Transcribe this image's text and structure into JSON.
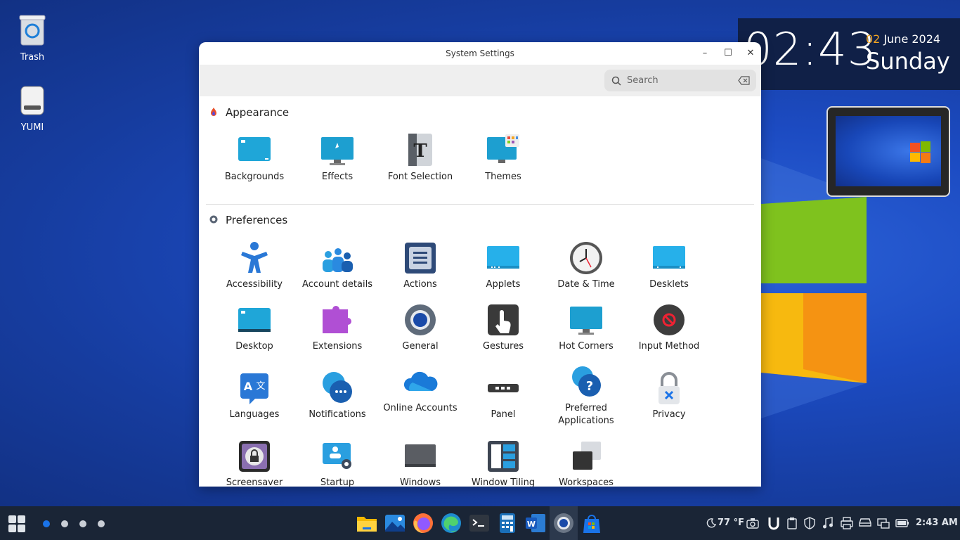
{
  "desktop": {
    "icons": [
      {
        "label": "Trash"
      },
      {
        "label": "YUMI"
      }
    ]
  },
  "clock": {
    "time": "02:43",
    "day": "02",
    "month_year": " June 2024",
    "weekday": "Sunday"
  },
  "window": {
    "title": "System Settings",
    "search_placeholder": "Search",
    "sections": {
      "appearance": {
        "heading": "Appearance",
        "items": [
          "Backgrounds",
          "Effects",
          "Font Selection",
          "Themes"
        ]
      },
      "preferences": {
        "heading": "Preferences",
        "items": [
          "Accessibility",
          "Account details",
          "Actions",
          "Applets",
          "Date & Time",
          "Desklets",
          "Desktop",
          "Extensions",
          "General",
          "Gestures",
          "Hot Corners",
          "Input Method",
          "Languages",
          "Notifications",
          "Online Accounts",
          "Panel",
          "Preferred Applications",
          "Privacy",
          "Screensaver",
          "Startup Applications",
          "Windows",
          "Window Tiling",
          "Workspaces"
        ]
      }
    }
  },
  "taskbar": {
    "weather": "77 °F",
    "clock": "2:43 AM",
    "apps": [
      "file-manager-icon",
      "image-viewer-icon",
      "firefox-icon",
      "edge-icon",
      "terminal-icon",
      "calculator-icon",
      "word-icon",
      "settings-icon",
      "store-icon"
    ]
  },
  "colors": {
    "accent": "#1a73e8",
    "taskbar": "#1a2536",
    "clock_day": "#f5a623"
  }
}
